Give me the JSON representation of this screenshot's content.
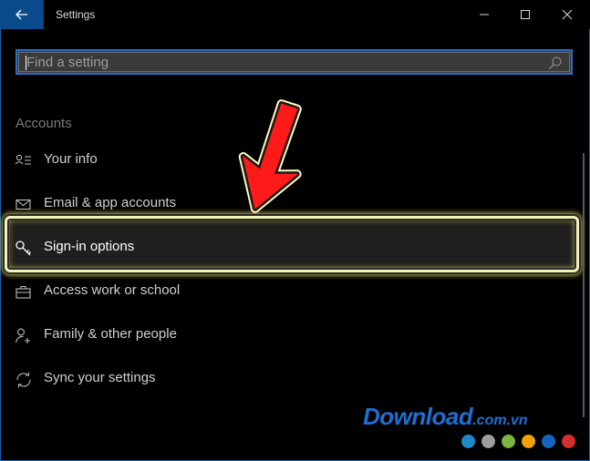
{
  "window": {
    "title": "Settings"
  },
  "search": {
    "placeholder": "Find a setting",
    "value": ""
  },
  "section": {
    "title": "Accounts"
  },
  "nav": {
    "items": [
      {
        "label": "Your info",
        "icon": "person-card-icon"
      },
      {
        "label": "Email & app accounts",
        "icon": "mail-icon"
      },
      {
        "label": "Sign-in options",
        "icon": "key-icon",
        "selected": true
      },
      {
        "label": "Access work or school",
        "icon": "briefcase-icon"
      },
      {
        "label": "Family & other people",
        "icon": "person-add-icon"
      },
      {
        "label": "Sync your settings",
        "icon": "sync-icon"
      }
    ]
  },
  "watermark": {
    "brand": "Download",
    "domain": ".com.vn",
    "dot_colors": [
      "#1e88c8",
      "#9e9e9e",
      "#7cb342",
      "#f0a000",
      "#1565c0",
      "#d32f2f"
    ]
  },
  "colors": {
    "accent": "#0a4a8a",
    "highlight_border": "#f3f0b8",
    "arrow": "#ff1a1a"
  }
}
